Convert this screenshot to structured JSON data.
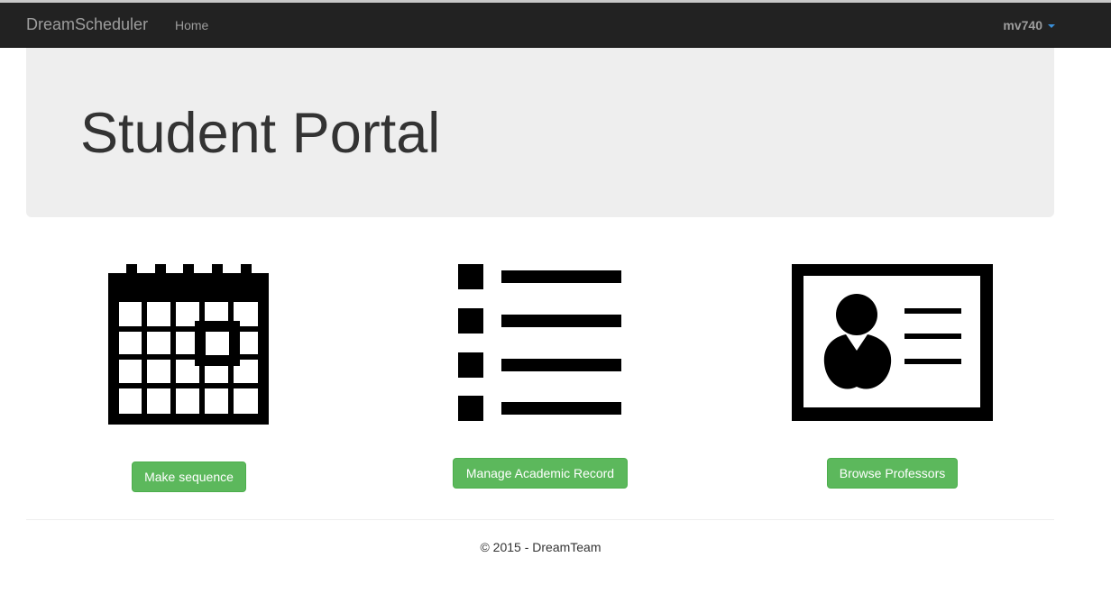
{
  "navbar": {
    "brand": "DreamScheduler",
    "home_link": "Home",
    "user": "mv740"
  },
  "jumbotron": {
    "title": "Student Portal"
  },
  "actions": [
    {
      "icon": "calendar-icon",
      "label": "Make sequence"
    },
    {
      "icon": "list-icon",
      "label": "Manage Academic Record"
    },
    {
      "icon": "id-card-icon",
      "label": "Browse Professors"
    }
  ],
  "footer": {
    "text": "© 2015 - DreamTeam"
  }
}
